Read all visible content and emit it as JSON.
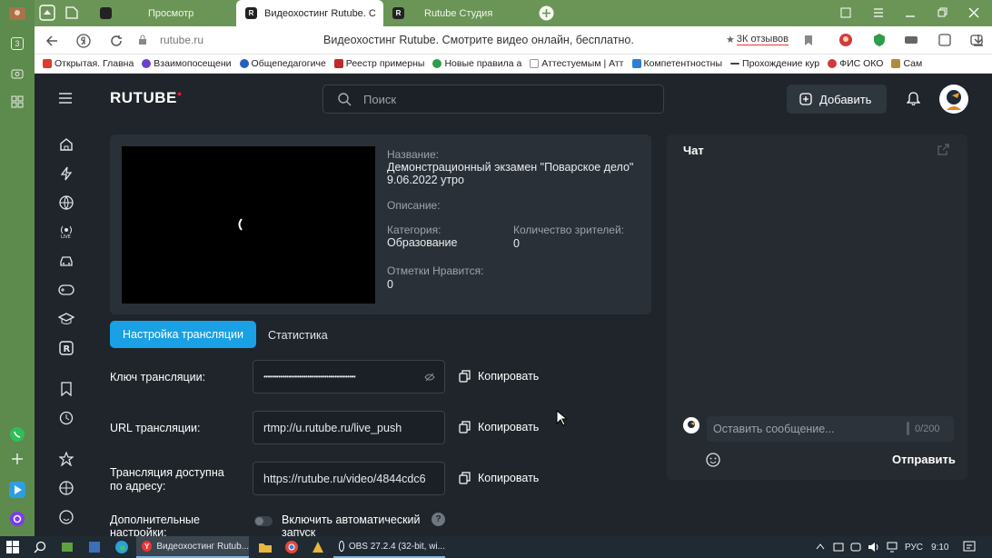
{
  "browser": {
    "tabs": [
      {
        "label": "Просмотр"
      },
      {
        "label": "Видеохостинг Rutube. С"
      },
      {
        "label": "Rutube Студия"
      }
    ],
    "url": "rutube.ru",
    "page_title": "Видеохостинг Rutube. Смотрите видео онлайн, бесплатно.",
    "reviews": "3К отзывов",
    "bookmarks": [
      "Открытая. Главна",
      "Взаимопосещени",
      "Общепедагогиче",
      "Реестр примерны",
      "Новые правила а",
      "Аттестуемым | Атт",
      "Компетентностны",
      "Прохождение кур",
      "ФИС ОКО",
      "Сам"
    ]
  },
  "window_strip": {
    "badge_a": "3",
    "badge_b": "3"
  },
  "header": {
    "logo": "RUTUBE",
    "search_placeholder": "Поиск",
    "add_label": "Добавить"
  },
  "stream": {
    "name_label": "Название:",
    "name_value": "Демонстрационный экзамен \"Поварское дело\" 9.06.2022 утро",
    "desc_label": "Описание:",
    "category_label": "Категория:",
    "category_value": "Образование",
    "viewers_label": "Количество зрителей:",
    "viewers_value": "0",
    "likes_label": "Отметки Нравится:",
    "likes_value": "0"
  },
  "tabs": {
    "settings": "Настройка трансляции",
    "stats": "Статистика"
  },
  "settings": {
    "key_label": "Ключ трансляции:",
    "key_value": "••••••••••••••••••••••••••••••••••••••••••••",
    "url_label": "URL трансляции:",
    "url_value": "rtmp://u.rutube.ru/live_push",
    "address_label_1": "Трансляция доступна",
    "address_label_2": "по адресу:",
    "address_value": "https://rutube.ru/video/4844cdc6",
    "copy_label": "Копировать",
    "extra_label_1": "Дополнительные",
    "extra_label_2": "настройки:",
    "autostart_1": "Включить автоматический",
    "autostart_2": "запуск",
    "autostart_on": false
  },
  "chat": {
    "title": "Чат",
    "input_placeholder": "Оставить сообщение...",
    "counter": "0/200",
    "send_label": "Отправить"
  },
  "taskbar": {
    "items": [
      "Видеохостинг Rutub...",
      "OBS 27.2.4 (32-bit, wi..."
    ],
    "lang": "РУС",
    "time": "9:10"
  },
  "colors": {
    "accent": "#1aa0e4",
    "page_bg": "#1f252b",
    "card_bg": "#2a3037",
    "tab_green": "#6b9557"
  }
}
